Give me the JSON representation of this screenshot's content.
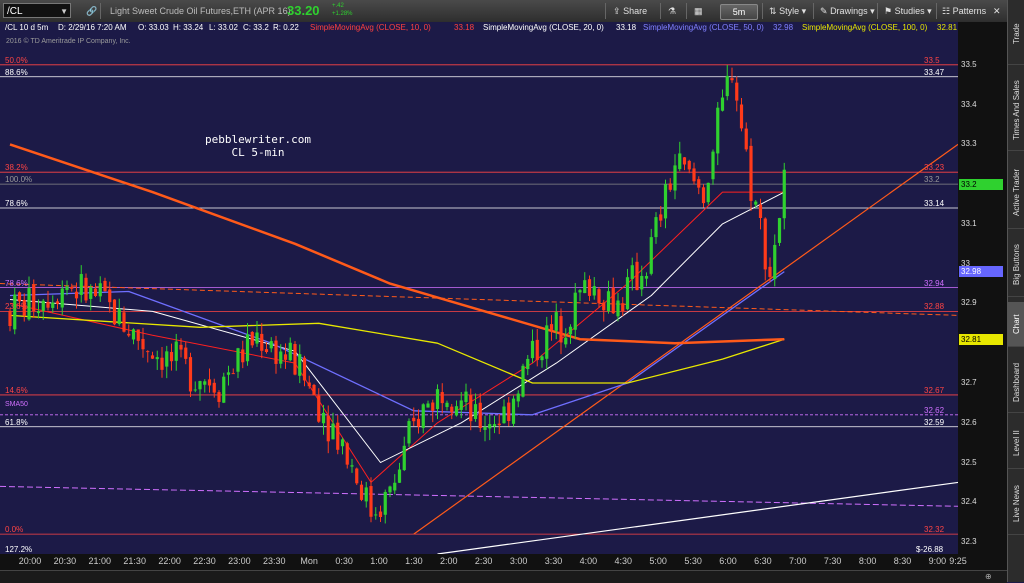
{
  "toolbar": {
    "symbol": "/CL",
    "description": "Light Sweet Crude Oil Futures,ETH (APR 16)",
    "last_price": "33.20",
    "change": "+.42",
    "change_pct": "+1.28%",
    "share_label": "Share",
    "timeframe": "5m",
    "style_label": "Style",
    "drawings_label": "Drawings",
    "studies_label": "Studies",
    "patterns_label": "Patterns"
  },
  "studybar": {
    "summary": "/CL 10 d 5m",
    "date": "D: 2/29/16 7:20 AM",
    "open": "O: 33.03",
    "high": "H: 33.24",
    "low": "L: 33.02",
    "close": "C: 33.2",
    "range": "R: 0.22",
    "sma10_label": "SimpleMovingAvg (CLOSE, 10, 0)",
    "sma10_value": "33.18",
    "sma20_label": "SimpleMovingAvg (CLOSE, 20, 0)",
    "sma20_value": "33.18",
    "sma50_label": "SimpleMovingAvg (CLOSE, 50, 0)",
    "sma50_value": "32.98",
    "sma100_label": "SimpleMovingAvg (CLOSE, 100, 0)",
    "sma100_value": "32.81"
  },
  "copyright": "2016 © TD Ameritrade IP Company, Inc.",
  "watermark": {
    "line1": "pebblewriter.com",
    "line2": "CL 5-min"
  },
  "levels": [
    {
      "pct": "50.0%",
      "value": "33.5",
      "price": 33.5,
      "color": "#ff4444",
      "line": "#ff4444"
    },
    {
      "pct": "88.6%",
      "value": "33.47",
      "price": 33.47,
      "color": "#ffffff",
      "line": "#ffffff"
    },
    {
      "pct": "38.2%",
      "value": "33.23",
      "price": 33.23,
      "color": "#ff4444",
      "line": "#ff4444"
    },
    {
      "pct": "100.0%",
      "value": "33.2",
      "price": 33.2,
      "color": "#999999",
      "line": "#888888"
    },
    {
      "pct": "78.6%",
      "value": "33.14",
      "price": 33.14,
      "color": "#ffffff",
      "line": "#ffffff"
    },
    {
      "pct": "78.6%",
      "value": "32.94",
      "price": 32.94,
      "color": "#d070ff",
      "line": "#d070ff"
    },
    {
      "pct": "23.6%",
      "value": "32.88",
      "price": 32.88,
      "color": "#ff4444",
      "line": "#ff4444"
    },
    {
      "pct": "14.6%",
      "value": "32.67",
      "price": 32.67,
      "color": "#ff4444",
      "line": "#ff4444"
    },
    {
      "pct": "",
      "value": "32.62",
      "price": 32.62,
      "color": "#d070ff",
      "line": "#d070ff"
    },
    {
      "pct": "61.8%",
      "value": "32.59",
      "price": 32.59,
      "color": "#ffffff",
      "line": "#ffffff"
    },
    {
      "pct": "0.0%",
      "value": "32.32",
      "price": 32.32,
      "color": "#ff4444",
      "line": "#ff4444"
    }
  ],
  "sma50_text": "SMA50",
  "bottom_pct": "127.2%",
  "bottom_value": "$-26.88",
  "yaxis": {
    "ticks": [
      "33.5",
      "33.4",
      "33.3",
      "33.2",
      "33.1",
      "33",
      "32.9",
      "32.8",
      "32.7",
      "32.6",
      "32.5",
      "32.4",
      "32.3"
    ],
    "tags": [
      {
        "text": "33.2",
        "price": 33.2,
        "bg": "#2fd12f",
        "fg": "#000000"
      },
      {
        "text": "32.98",
        "price": 32.98,
        "bg": "#6666ff",
        "fg": "#ffffff"
      },
      {
        "text": "32.81",
        "price": 32.81,
        "bg": "#e8e800",
        "fg": "#000000"
      }
    ]
  },
  "xaxis": [
    "20:00",
    "20:30",
    "21:00",
    "21:30",
    "22:00",
    "22:30",
    "23:00",
    "23:30",
    "Mon",
    "0:30",
    "1:00",
    "1:30",
    "2:00",
    "2:30",
    "3:00",
    "3:30",
    "4:00",
    "4:30",
    "5:00",
    "5:30",
    "6:00",
    "6:30",
    "7:00",
    "7:30",
    "8:00",
    "8:30",
    "9:00",
    "9:25"
  ],
  "sidebar": [
    "Trade",
    "Times And Sales",
    "Active Trader",
    "Big Buttons",
    "Chart",
    "Dashboard",
    "Level II",
    "Live News"
  ],
  "sidebar_active": "Chart",
  "colors": {
    "background": "#1c1a47",
    "up": "#2fd12f",
    "down": "#ff3a1a",
    "sma10": "#ff2020",
    "sma20": "#ffffff",
    "sma50": "#6f6fff",
    "sma100": "#e8e800",
    "sma200": "#ff5a1a"
  },
  "chart_data": {
    "type": "candlestick",
    "interval": "5m",
    "ylim": [
      32.27,
      33.58
    ],
    "x": [
      "20:00",
      "20:30",
      "21:00",
      "21:30",
      "22:00",
      "22:30",
      "23:00",
      "23:30",
      "Mon",
      "0:30",
      "1:00",
      "1:30",
      "2:00",
      "2:30",
      "3:00",
      "3:30",
      "4:00",
      "4:30",
      "5:00",
      "5:30",
      "6:00",
      "6:30",
      "7:00",
      "7:30"
    ],
    "anchors": [
      [
        0,
        32.88
      ],
      [
        12,
        32.95
      ],
      [
        20,
        32.9
      ],
      [
        28,
        32.8
      ],
      [
        36,
        32.74
      ],
      [
        44,
        32.7
      ],
      [
        52,
        32.82
      ],
      [
        60,
        32.75
      ],
      [
        70,
        32.55
      ],
      [
        76,
        32.38
      ],
      [
        80,
        32.42
      ],
      [
        86,
        32.62
      ],
      [
        92,
        32.7
      ],
      [
        98,
        32.6
      ],
      [
        104,
        32.62
      ],
      [
        110,
        32.78
      ],
      [
        116,
        32.85
      ],
      [
        122,
        32.95
      ],
      [
        128,
        32.9
      ],
      [
        134,
        33.0
      ],
      [
        140,
        33.25
      ],
      [
        146,
        33.18
      ],
      [
        152,
        33.5
      ],
      [
        156,
        33.2
      ],
      [
        160,
        32.98
      ],
      [
        163,
        33.2
      ]
    ],
    "series": [
      {
        "name": "SimpleMovingAvg (CLOSE, 10, 0)",
        "values": [
          [
            0,
            32.9
          ],
          [
            30,
            32.82
          ],
          [
            60,
            32.75
          ],
          [
            76,
            32.45
          ],
          [
            90,
            32.6
          ],
          [
            110,
            32.75
          ],
          [
            130,
            32.95
          ],
          [
            150,
            33.18
          ],
          [
            163,
            33.18
          ]
        ]
      },
      {
        "name": "SimpleMovingAvg (CLOSE, 20, 0)",
        "values": [
          [
            0,
            32.91
          ],
          [
            30,
            32.88
          ],
          [
            60,
            32.78
          ],
          [
            78,
            32.5
          ],
          [
            95,
            32.6
          ],
          [
            115,
            32.75
          ],
          [
            135,
            32.92
          ],
          [
            150,
            33.1
          ],
          [
            163,
            33.18
          ]
        ]
      },
      {
        "name": "SimpleMovingAvg (CLOSE, 50, 0)",
        "values": [
          [
            0,
            32.92
          ],
          [
            25,
            32.93
          ],
          [
            55,
            32.8
          ],
          [
            85,
            32.63
          ],
          [
            110,
            32.62
          ],
          [
            130,
            32.7
          ],
          [
            150,
            32.87
          ],
          [
            163,
            32.98
          ]
        ]
      },
      {
        "name": "SimpleMovingAvg (CLOSE, 100, 0)",
        "values": [
          [
            0,
            32.87
          ],
          [
            40,
            32.84
          ],
          [
            65,
            32.85
          ],
          [
            90,
            32.8
          ],
          [
            110,
            32.7
          ],
          [
            130,
            32.7
          ],
          [
            150,
            32.76
          ],
          [
            163,
            32.81
          ]
        ]
      },
      {
        "name": "SMA200",
        "values": [
          [
            0,
            33.3
          ],
          [
            30,
            33.18
          ],
          [
            60,
            33.05
          ],
          [
            80,
            32.95
          ],
          [
            100,
            32.88
          ],
          [
            120,
            32.81
          ],
          [
            140,
            32.8
          ],
          [
            163,
            32.81
          ]
        ]
      }
    ],
    "trendlines": [
      {
        "from": [
          85,
          32.32
        ],
        "to": [
          195,
          33.3
        ]
      },
      {
        "from": [
          0,
          32.95
        ],
        "to": [
          195,
          32.87
        ]
      },
      {
        "from": [
          0,
          32.44
        ],
        "to": [
          195,
          32.39
        ]
      },
      {
        "from": [
          90,
          32.27
        ],
        "to": [
          195,
          32.45
        ]
      }
    ]
  }
}
